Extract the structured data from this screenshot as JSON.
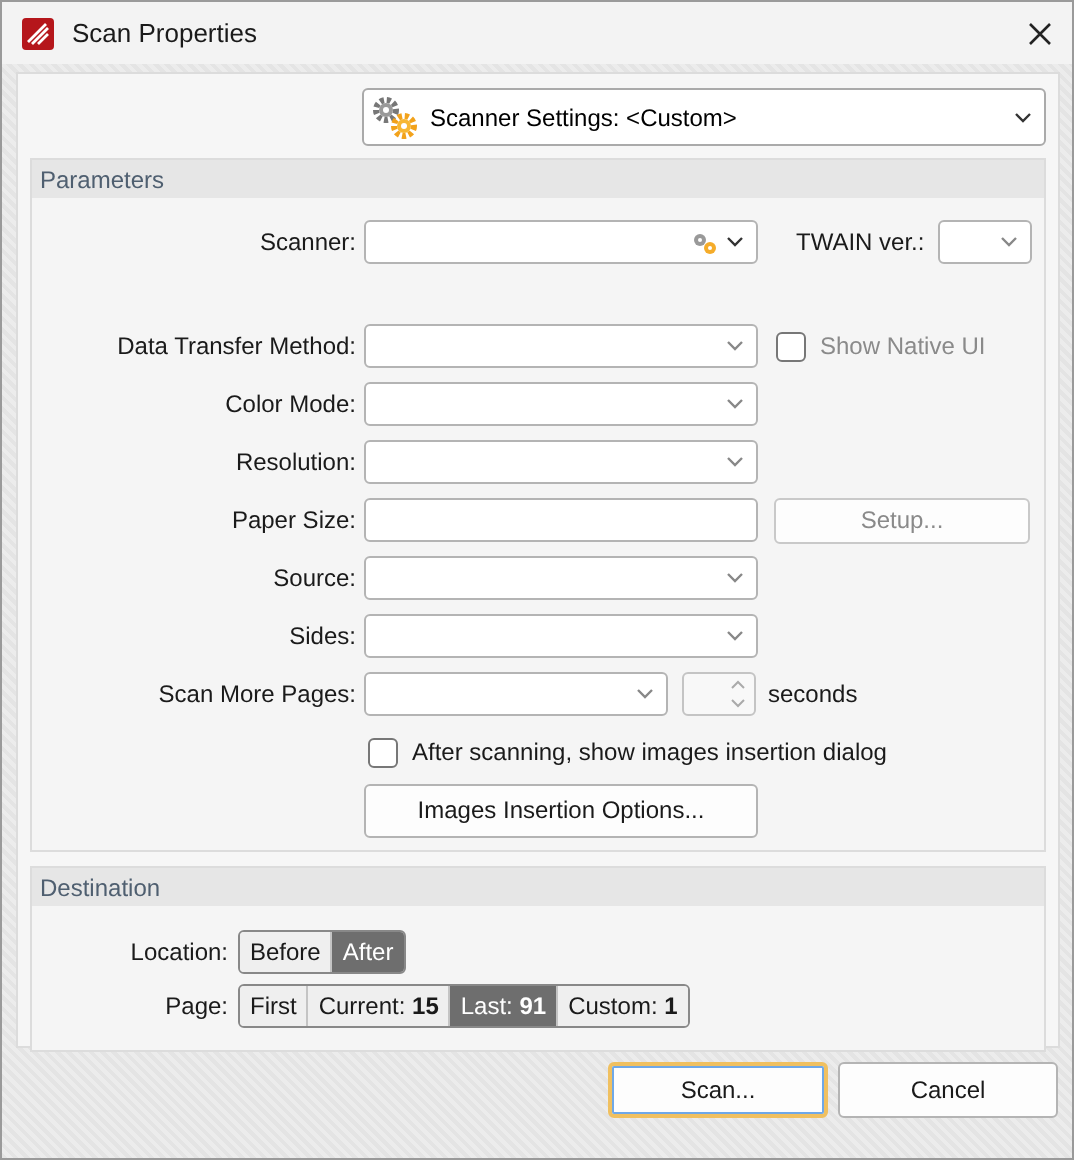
{
  "window": {
    "title": "Scan Properties"
  },
  "settings_dropdown": {
    "label": "Scanner Settings:  <Custom>"
  },
  "parameters": {
    "title": "Parameters",
    "fields": [
      {
        "kind": "scanner",
        "label": "Scanner:",
        "extra_label": "TWAIN ver.:"
      },
      {
        "kind": "combo",
        "label": "Data Transfer Method:",
        "checkbox": {
          "label": "Show Native UI",
          "checked": false,
          "disabled": true
        }
      },
      {
        "kind": "combo",
        "label": "Color Mode:"
      },
      {
        "kind": "combo",
        "label": "Resolution:"
      },
      {
        "kind": "text",
        "label": "Paper Size:",
        "button": {
          "label": "Setup...",
          "disabled": true
        }
      },
      {
        "kind": "combo",
        "label": "Source:"
      },
      {
        "kind": "combo",
        "label": "Sides:"
      },
      {
        "kind": "combo_spin",
        "label": "Scan More Pages:",
        "unit": "seconds"
      }
    ],
    "insertion_checkbox": {
      "label": "After scanning, show images insertion dialog",
      "checked": false
    },
    "options_button": "Images Insertion Options..."
  },
  "destination": {
    "title": "Destination",
    "rows": [
      {
        "label": "Location:",
        "options": [
          {
            "label": "Before",
            "selected": false
          },
          {
            "label": "After",
            "selected": true
          }
        ]
      },
      {
        "label": "Page:",
        "options": [
          {
            "label": "First",
            "selected": false
          },
          {
            "label": "Current: **15**",
            "selected": false
          },
          {
            "label": "Last: **91**",
            "selected": true
          },
          {
            "label": "Custom: **1**",
            "selected": false
          }
        ]
      }
    ]
  },
  "buttons": [
    {
      "label": "Scan...",
      "default": true
    },
    {
      "label": "Cancel",
      "default": false
    }
  ]
}
